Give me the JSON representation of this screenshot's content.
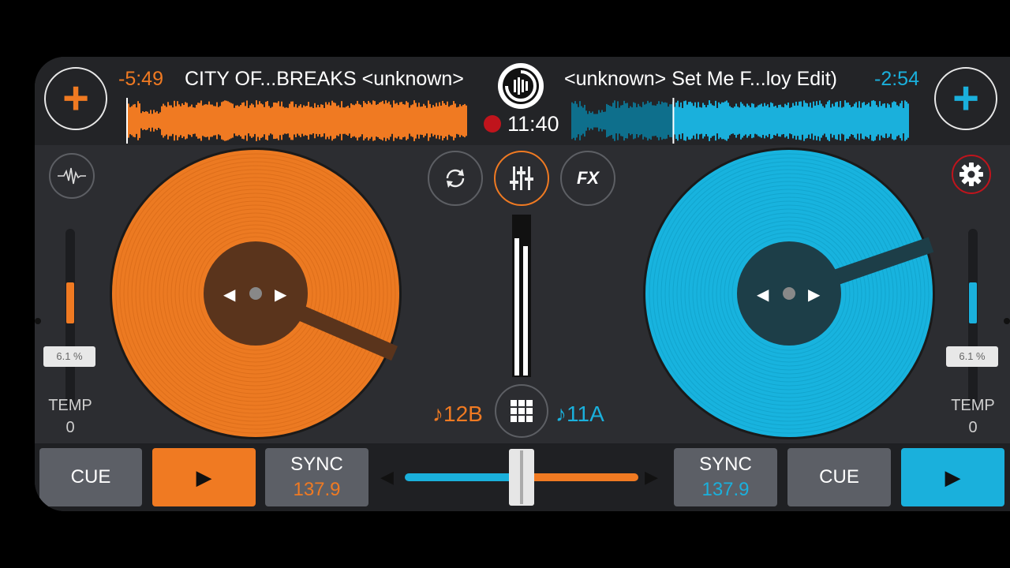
{
  "deck_a": {
    "time_remaining": "-5:49",
    "title": "CITY OF...BREAKS <unknown>",
    "key": "♪12B",
    "pitch": "6.1 %",
    "pitch_level": 0.46,
    "tempo_label": "TEMP",
    "tempo_value": "0",
    "cue_label": "CUE",
    "sync_label": "SYNC",
    "bpm": "137.9",
    "load_icon": "plus-icon",
    "color": "#f07a22"
  },
  "deck_b": {
    "time_remaining": "-2:54",
    "title": "<unknown>  Set Me F...loy Edit)",
    "key": "♪11A",
    "pitch": "6.1 %",
    "pitch_level": 0.46,
    "tempo_label": "TEMP",
    "tempo_value": "0",
    "cue_label": "CUE",
    "sync_label": "SYNC",
    "bpm": "137.9",
    "load_icon": "plus-icon",
    "color": "#1ab0dc"
  },
  "center": {
    "clock": "11:40",
    "recording": true,
    "fx_label": "FX",
    "crossfader_position": 0.5
  },
  "icons": {
    "load": "+",
    "play": "▶",
    "nav_left": "◀",
    "nav_right": "▶",
    "xfader_left": "◀",
    "xfader_right": "▶"
  },
  "colors": {
    "accent_a": "#f07a22",
    "accent_b": "#1ab0dc",
    "background": "#2c2d31",
    "record": "#c0141c"
  }
}
